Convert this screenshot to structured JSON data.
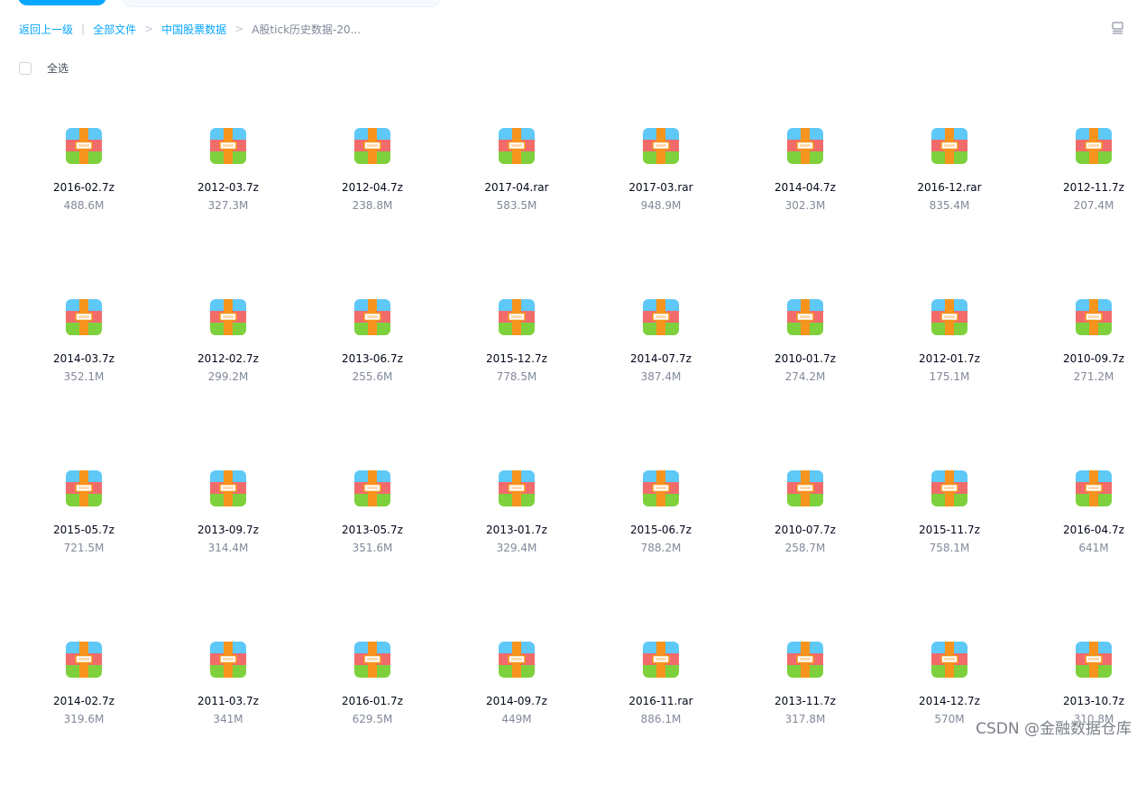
{
  "breadcrumb": {
    "back": "返回上一级",
    "items": [
      "全部文件",
      "中国股票数据",
      "A股tick历史数据-20..."
    ]
  },
  "select_all_label": "全选",
  "icon_name": "archive-file-icon",
  "files": [
    {
      "name": "2016-02.7z",
      "size": "488.6M"
    },
    {
      "name": "2012-03.7z",
      "size": "327.3M"
    },
    {
      "name": "2012-04.7z",
      "size": "238.8M"
    },
    {
      "name": "2017-04.rar",
      "size": "583.5M"
    },
    {
      "name": "2017-03.rar",
      "size": "948.9M"
    },
    {
      "name": "2014-04.7z",
      "size": "302.3M"
    },
    {
      "name": "2016-12.rar",
      "size": "835.4M"
    },
    {
      "name": "2012-11.7z",
      "size": "207.4M"
    },
    {
      "name": "2014-03.7z",
      "size": "352.1M"
    },
    {
      "name": "2012-02.7z",
      "size": "299.2M"
    },
    {
      "name": "2013-06.7z",
      "size": "255.6M"
    },
    {
      "name": "2015-12.7z",
      "size": "778.5M"
    },
    {
      "name": "2014-07.7z",
      "size": "387.4M"
    },
    {
      "name": "2010-01.7z",
      "size": "274.2M"
    },
    {
      "name": "2012-01.7z",
      "size": "175.1M"
    },
    {
      "name": "2010-09.7z",
      "size": "271.2M"
    },
    {
      "name": "2015-05.7z",
      "size": "721.5M"
    },
    {
      "name": "2013-09.7z",
      "size": "314.4M"
    },
    {
      "name": "2013-05.7z",
      "size": "351.6M"
    },
    {
      "name": "2013-01.7z",
      "size": "329.4M"
    },
    {
      "name": "2015-06.7z",
      "size": "788.2M"
    },
    {
      "name": "2010-07.7z",
      "size": "258.7M"
    },
    {
      "name": "2015-11.7z",
      "size": "758.1M"
    },
    {
      "name": "2016-04.7z",
      "size": "641M"
    },
    {
      "name": "2014-02.7z",
      "size": "319.6M"
    },
    {
      "name": "2011-03.7z",
      "size": "341M"
    },
    {
      "name": "2016-01.7z",
      "size": "629.5M"
    },
    {
      "name": "2014-09.7z",
      "size": "449M"
    },
    {
      "name": "2016-11.rar",
      "size": "886.1M"
    },
    {
      "name": "2013-11.7z",
      "size": "317.8M"
    },
    {
      "name": "2014-12.7z",
      "size": "570M"
    },
    {
      "name": "2013-10.7z",
      "size": "310.8M"
    }
  ],
  "watermark": "CSDN @金融数据仓库",
  "colors": {
    "accent": "#06a7ff",
    "icon_top": "#5ec8f7",
    "icon_mid": "#f26b6b",
    "icon_bottom": "#7ed13c",
    "icon_strap": "#f7941d"
  }
}
